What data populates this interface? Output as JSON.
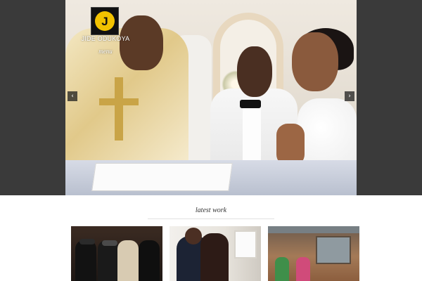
{
  "site": {
    "brand_name": "JIDE ODUKOYA",
    "logo_letter": "J",
    "logo_colors": {
      "circle": "#f2c200",
      "square": "#111111"
    },
    "menu_label": "menu"
  },
  "slideshow": {
    "prev_icon": "chevron-left-icon",
    "next_icon": "chevron-right-icon",
    "prev_glyph": "‹",
    "next_glyph": "›",
    "background_color": "#3a3a3a"
  },
  "latest_work": {
    "title": "latest work",
    "thumbnails": [
      {
        "name": "thumbnail-1"
      },
      {
        "name": "thumbnail-2"
      },
      {
        "name": "thumbnail-3"
      }
    ]
  }
}
